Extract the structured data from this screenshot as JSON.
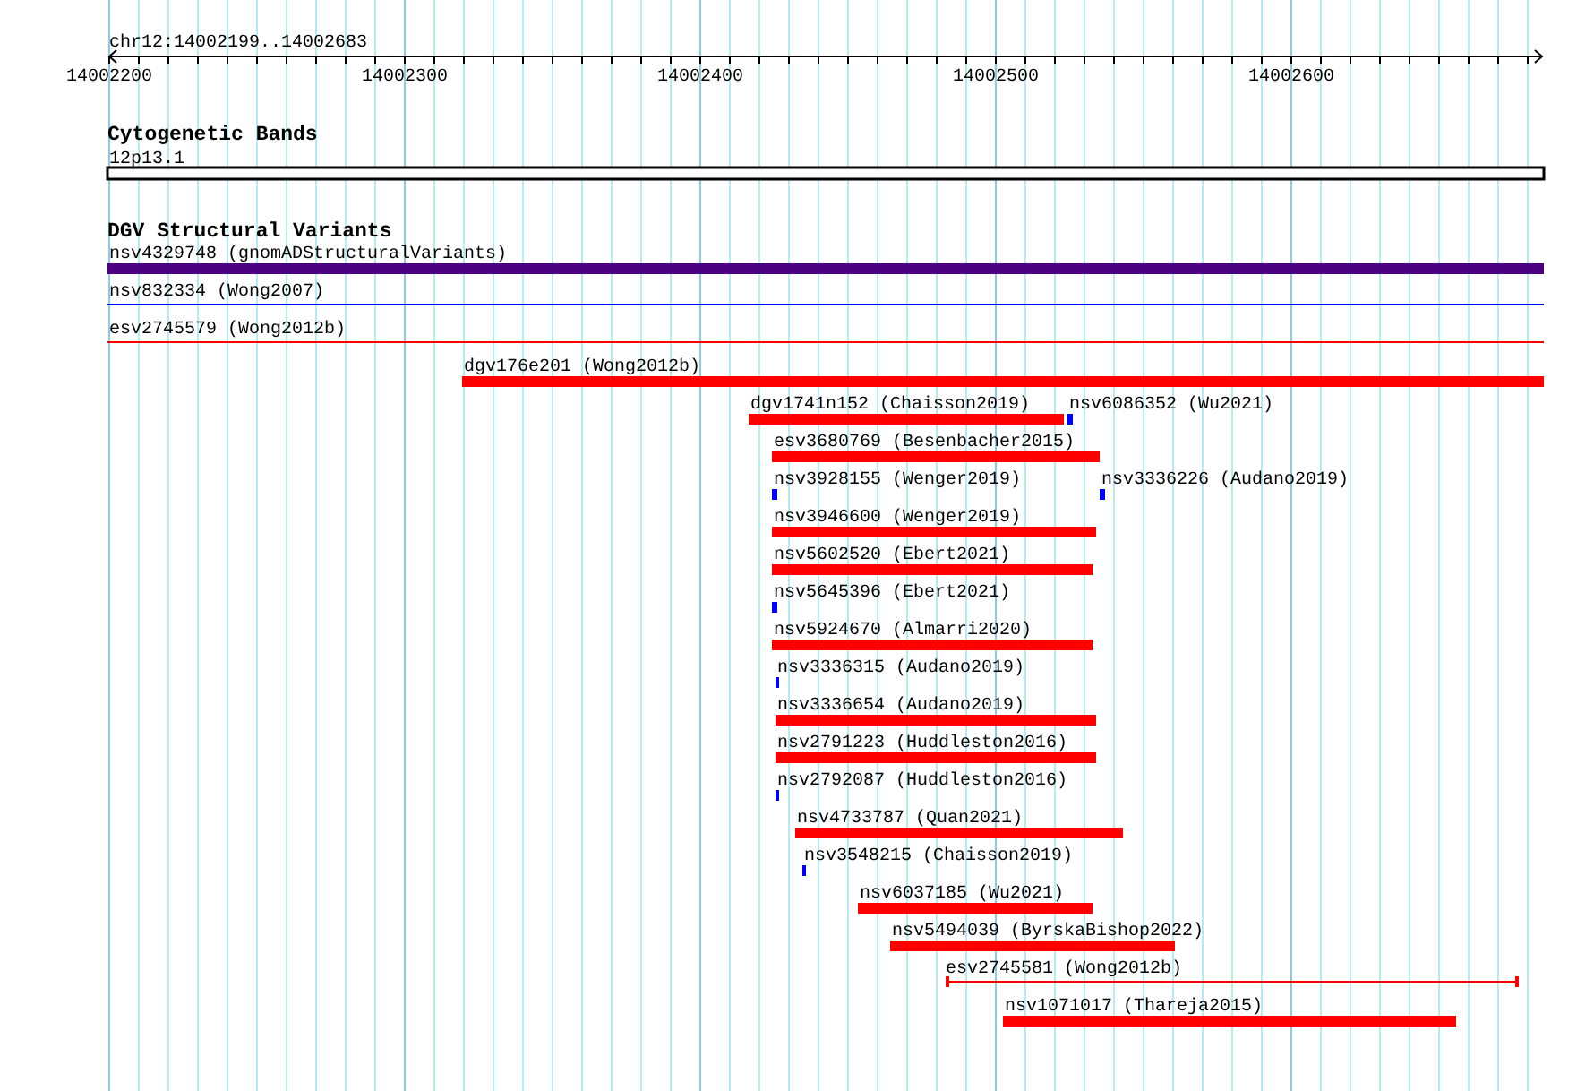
{
  "ruler": {
    "location": "chr12:14002199..14002683",
    "ticks": [
      "14002200",
      "14002300",
      "14002400",
      "14002500",
      "14002600"
    ]
  },
  "tracks": [
    {
      "title": "Cytogenetic Bands",
      "features": [
        {
          "label": "12p13.1",
          "kind": "band",
          "color": "#000000"
        }
      ]
    },
    {
      "title": "DGV Structural Variants",
      "features": [
        {
          "label": "nsv4329748 (gnomADStructuralVariants)",
          "kind": "bar",
          "color": "#4b0082"
        },
        {
          "label": "nsv832334 (Wong2007)",
          "kind": "line",
          "color": "#0000ff"
        },
        {
          "label": "esv2745579 (Wong2012b)",
          "kind": "line",
          "color": "#ff0000"
        },
        {
          "label": "dgv176e201 (Wong2012b)",
          "kind": "bar",
          "color": "#ff0000"
        },
        {
          "label": "dgv1741n152 (Chaisson2019)",
          "kind": "bar",
          "color": "#ff0000"
        },
        {
          "label": "nsv6086352 (Wu2021)",
          "kind": "bar",
          "color": "#0000ff"
        },
        {
          "label": "esv3680769 (Besenbacher2015)",
          "kind": "bar",
          "color": "#ff0000"
        },
        {
          "label": "nsv3928155 (Wenger2019)",
          "kind": "bar",
          "color": "#0000ff"
        },
        {
          "label": "nsv3336226 (Audano2019)",
          "kind": "bar",
          "color": "#0000ff"
        },
        {
          "label": "nsv3946600 (Wenger2019)",
          "kind": "bar",
          "color": "#ff0000"
        },
        {
          "label": "nsv5602520 (Ebert2021)",
          "kind": "bar",
          "color": "#ff0000"
        },
        {
          "label": "nsv5645396 (Ebert2021)",
          "kind": "bar",
          "color": "#0000ff"
        },
        {
          "label": "nsv5924670 (Almarri2020)",
          "kind": "bar",
          "color": "#ff0000"
        },
        {
          "label": "nsv3336315 (Audano2019)",
          "kind": "bar",
          "color": "#0000ff"
        },
        {
          "label": "nsv3336654 (Audano2019)",
          "kind": "bar",
          "color": "#ff0000"
        },
        {
          "label": "nsv2791223 (Huddleston2016)",
          "kind": "bar",
          "color": "#ff0000"
        },
        {
          "label": "nsv2792087 (Huddleston2016)",
          "kind": "bar",
          "color": "#0000ff"
        },
        {
          "label": "nsv4733787 (Quan2021)",
          "kind": "bar",
          "color": "#ff0000"
        },
        {
          "label": "nsv3548215 (Chaisson2019)",
          "kind": "bar",
          "color": "#0000ff"
        },
        {
          "label": "nsv6037185 (Wu2021)",
          "kind": "bar",
          "color": "#ff0000"
        },
        {
          "label": "nsv5494039 (ByrskaBishop2022)",
          "kind": "bar",
          "color": "#ff0000"
        },
        {
          "label": "esv2745581 (Wong2012b)",
          "kind": "span",
          "color": "#ff0000"
        },
        {
          "label": "nsv1071017 (Thareja2015)",
          "kind": "bar",
          "color": "#ff0000"
        }
      ]
    }
  ]
}
